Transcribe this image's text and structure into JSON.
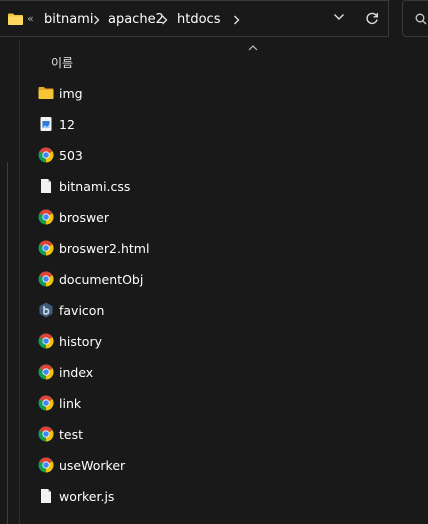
{
  "address_bar": {
    "overflow": "«",
    "crumbs": [
      "bitnami",
      "apache2",
      "htdocs"
    ]
  },
  "file_list": {
    "column_name": "이름",
    "items": [
      {
        "name": "img",
        "icon": "folder-icon"
      },
      {
        "name": "12",
        "icon": "image-file-icon"
      },
      {
        "name": "503",
        "icon": "chrome-icon"
      },
      {
        "name": "bitnami.css",
        "icon": "file-icon"
      },
      {
        "name": "broswer",
        "icon": "chrome-icon"
      },
      {
        "name": "broswer2.html",
        "icon": "chrome-icon"
      },
      {
        "name": "documentObj",
        "icon": "chrome-icon"
      },
      {
        "name": "favicon",
        "icon": "favicon-file-icon"
      },
      {
        "name": "history",
        "icon": "chrome-icon"
      },
      {
        "name": "index",
        "icon": "chrome-icon"
      },
      {
        "name": "link",
        "icon": "chrome-icon"
      },
      {
        "name": "test",
        "icon": "chrome-icon"
      },
      {
        "name": "useWorker",
        "icon": "chrome-icon"
      },
      {
        "name": "worker.js",
        "icon": "file-icon"
      }
    ]
  },
  "colors": {
    "background": "#191919",
    "folder": "#f8c537",
    "chrome_red": "#db4437",
    "chrome_yellow": "#f4c20d",
    "chrome_green": "#0f9d58",
    "chrome_blue": "#4285f4"
  }
}
